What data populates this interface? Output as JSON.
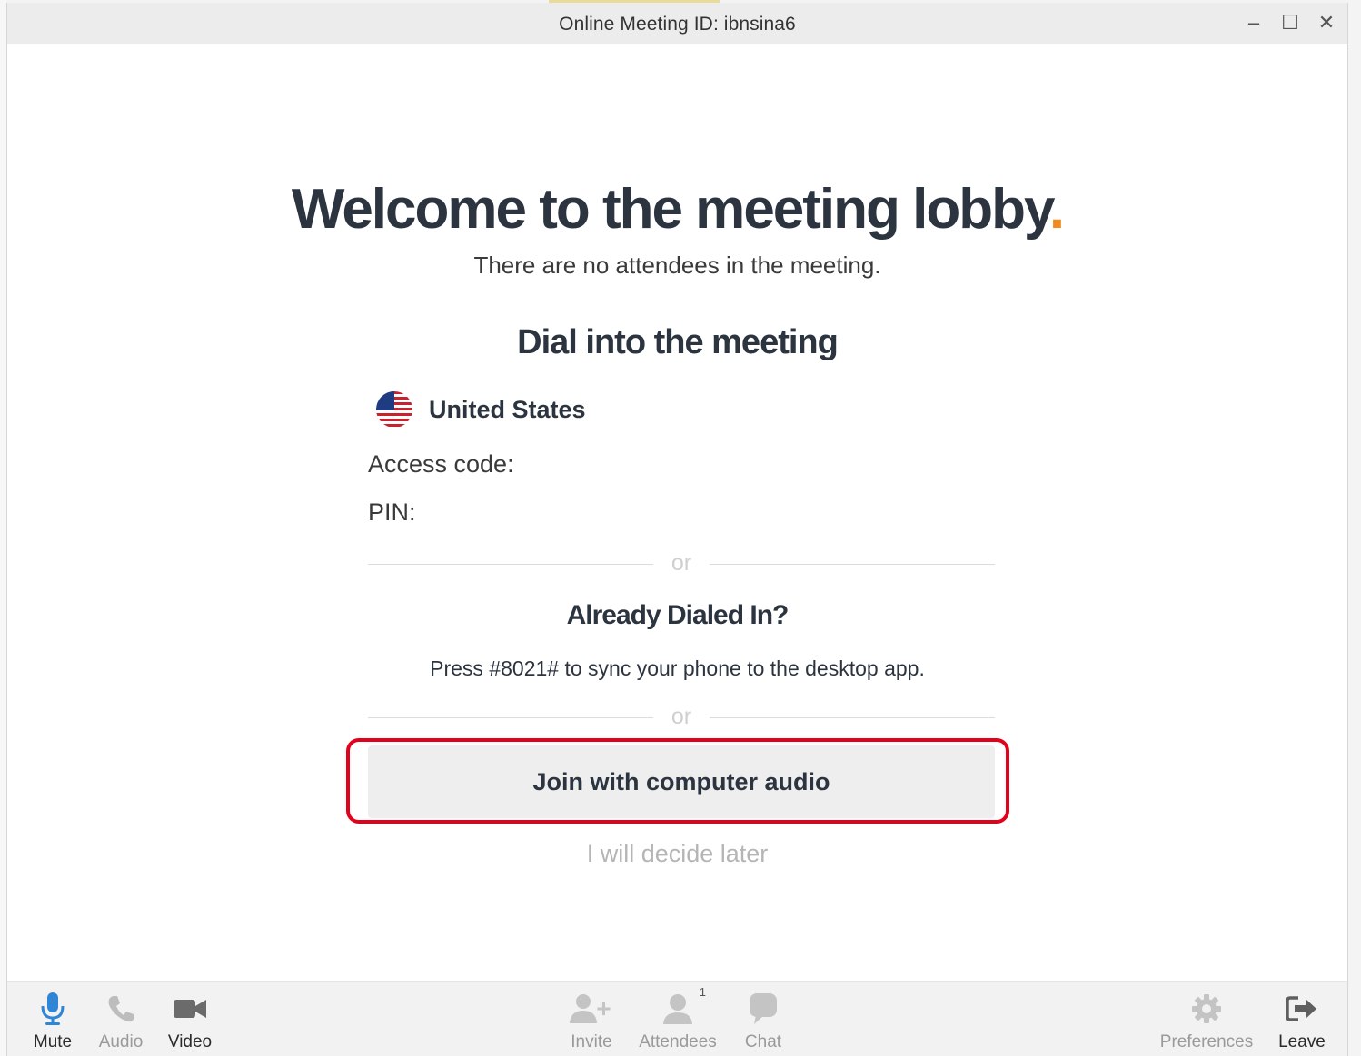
{
  "window": {
    "title": "Online Meeting ID: ibnsina6",
    "controls": {
      "minimize": "–",
      "maximize": "☐",
      "close": "✕"
    }
  },
  "lobby": {
    "headline": "Welcome to the meeting lobby",
    "headline_dot": ".",
    "subline": "There are no attendees in the meeting.",
    "dial_heading": "Dial into the meeting",
    "country": "United States",
    "access_code_label": "Access code:",
    "pin_label": "PIN:",
    "or_label": "or",
    "already_heading": "Already Dialed In?",
    "press_text": "Press #8021# to sync your phone to the desktop app.",
    "join_button": "Join with computer audio",
    "decide_later": "I will decide later"
  },
  "toolbar": {
    "mute": "Mute",
    "audio": "Audio",
    "video": "Video",
    "invite": "Invite",
    "attendees": "Attendees",
    "attendees_count": "1",
    "chat": "Chat",
    "preferences": "Preferences",
    "leave": "Leave"
  },
  "colors": {
    "accent_dot": "#f08c1f",
    "highlight_border": "#e3001b",
    "mic_active": "#2f86d6",
    "heading_text": "#2c3440"
  }
}
